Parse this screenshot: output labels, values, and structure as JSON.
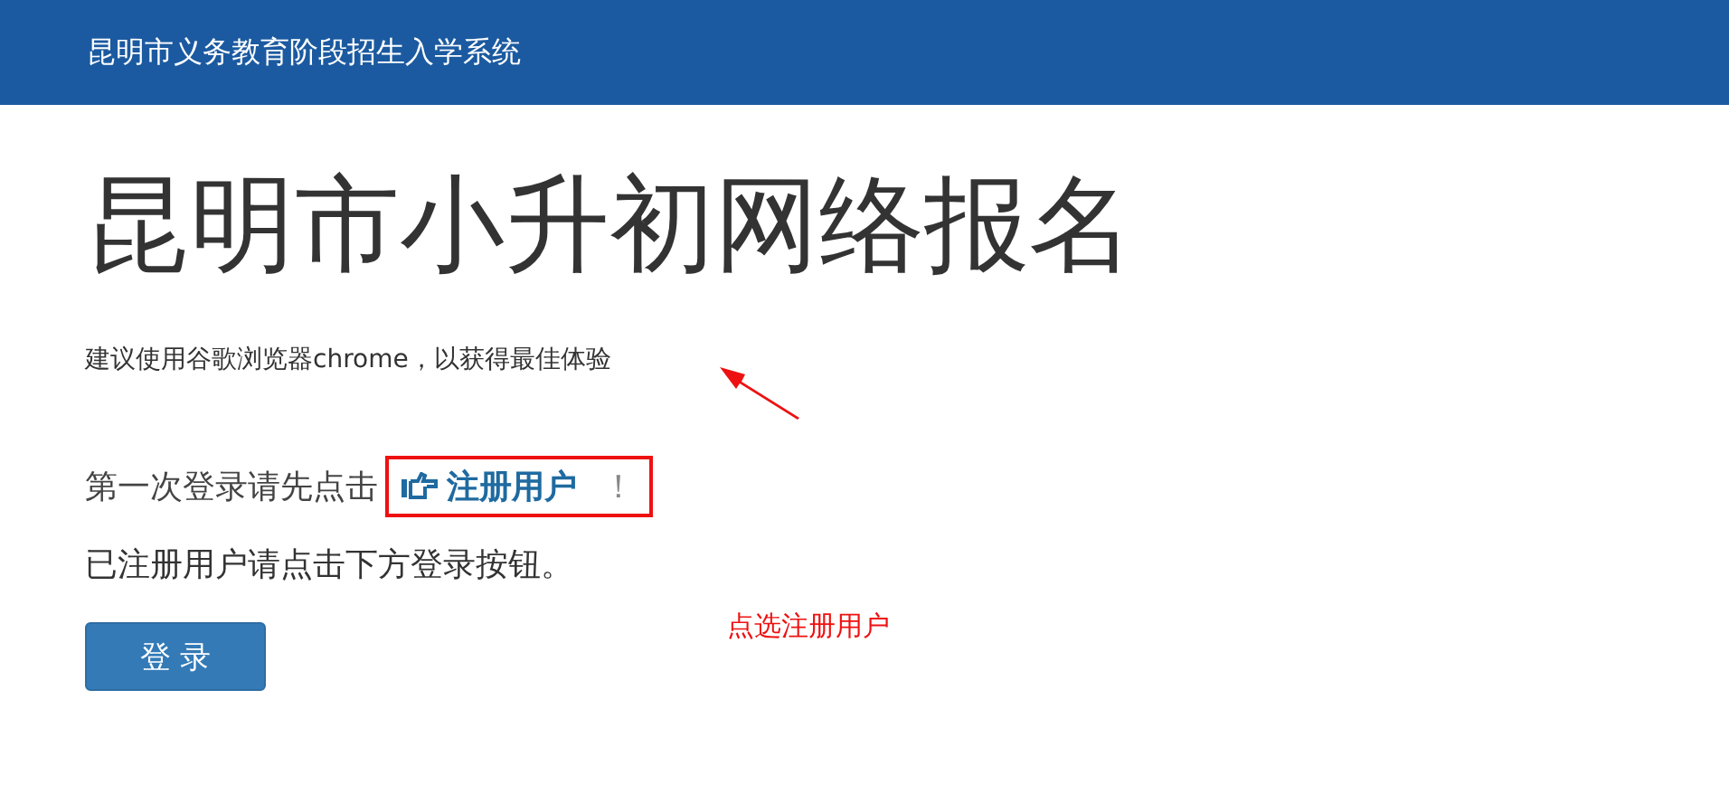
{
  "header": {
    "title": "昆明市义务教育阶段招生入学系统"
  },
  "heading": "昆明市小升初网络报名",
  "browser_note": "建议使用谷歌浏览器chrome，以获得最佳体验",
  "first_login": {
    "text": "第一次登录请先点击",
    "link": "注册用户",
    "suffix": "！"
  },
  "registered_note": "已注册用户请点击下方登录按钮。",
  "login_button": "登 录",
  "annotation": {
    "text": "点选注册用户"
  }
}
